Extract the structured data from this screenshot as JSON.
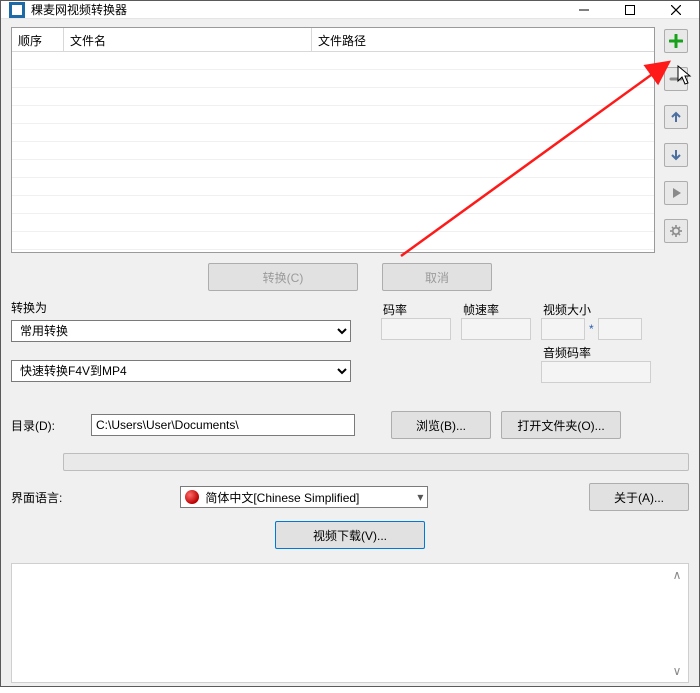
{
  "window": {
    "title": "稞麦网视频转换器"
  },
  "table": {
    "headers": {
      "order": "顺序",
      "filename": "文件名",
      "filepath": "文件路径"
    }
  },
  "side_tools": {
    "add": "add-icon",
    "remove": "remove-icon",
    "move_up": "arrow-up-icon",
    "move_down": "arrow-down-icon",
    "play": "play-icon",
    "settings": "gear-icon"
  },
  "buttons": {
    "convert": "转换(C)",
    "cancel": "取消",
    "browse": "浏览(B)...",
    "open_folder": "打开文件夹(O)...",
    "about": "关于(A)...",
    "download": "视频下载(V)..."
  },
  "labels": {
    "convert_to": "转换为",
    "bitrate": "码率",
    "framerate": "帧速率",
    "video_size": "视频大小",
    "audio_bitrate": "音频码率",
    "directory": "目录(D):",
    "ui_language": "界面语言:"
  },
  "selects": {
    "preset_group": "常用转换",
    "preset_item": "快速转换F4V到MP4",
    "language": "简体中文[Chinese Simplified]"
  },
  "fields": {
    "directory_value": "C:\\Users\\User\\Documents\\",
    "video_size_sep": "*"
  }
}
